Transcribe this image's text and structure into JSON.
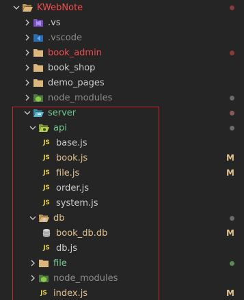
{
  "colors": {
    "background": "#252526",
    "default_text": "#cccccc",
    "error_red": "#f14c4c",
    "dim_text": "#8b8b8b",
    "modified_yellow": "#e2c08d",
    "untracked_green": "#73c991",
    "folder_tan": "#dcb67a",
    "highlight_border": "#c8252c",
    "dot_red": "#8a3a3a",
    "dot_gray": "#6a6a6a",
    "dot_green": "#5a8a5a"
  },
  "tree": {
    "root": {
      "label": "KWebNote",
      "icon": "folder-open-icon"
    },
    "items": [
      {
        "label": ".vs",
        "icon": "vs-folder-icon"
      },
      {
        "label": ".vscode",
        "icon": "vscode-folder-icon"
      },
      {
        "label": "book_admin",
        "icon": "folder-icon"
      },
      {
        "label": "book_shop",
        "icon": "folder-icon"
      },
      {
        "label": "demo_pages",
        "icon": "folder-icon"
      },
      {
        "label": "node_modules",
        "icon": "node-folder-icon"
      },
      {
        "label": "server",
        "icon": "server-folder-open-icon"
      },
      {
        "label": "api",
        "icon": "api-folder-open-icon"
      },
      {
        "label": "base.js",
        "icon": "js-file-icon"
      },
      {
        "label": "book.js",
        "icon": "js-file-icon",
        "badge": "M"
      },
      {
        "label": "file.js",
        "icon": "js-file-icon",
        "badge": "M"
      },
      {
        "label": "order.js",
        "icon": "js-file-icon"
      },
      {
        "label": "system.js",
        "icon": "js-file-icon"
      },
      {
        "label": "db",
        "icon": "db-folder-open-icon"
      },
      {
        "label": "book_db.db",
        "icon": "database-file-icon",
        "badge": "M"
      },
      {
        "label": "db.js",
        "icon": "js-file-icon"
      },
      {
        "label": "file",
        "icon": "folder-icon"
      },
      {
        "label": "node_modules",
        "icon": "node-folder-icon"
      },
      {
        "label": "index.js",
        "icon": "js-file-icon",
        "badge": "M"
      }
    ]
  },
  "icons": {
    "js_text": "JS"
  }
}
